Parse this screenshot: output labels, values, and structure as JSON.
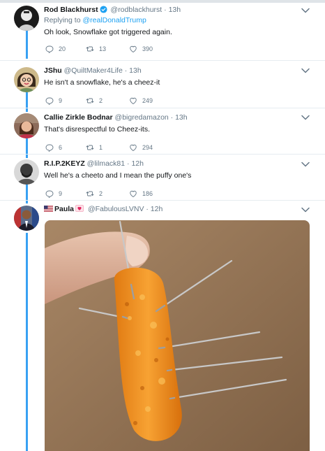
{
  "tweets": [
    {
      "name": "Rod Blackhurst",
      "handle": "@rodblackhurst",
      "time": "13h",
      "verified": true,
      "reply_prefix": "Replying to",
      "reply_to": "@realDonaldTrump",
      "text": "Oh look, Snowflake got triggered again.",
      "replies": "20",
      "retweets": "13",
      "likes": "390"
    },
    {
      "name": "JShu",
      "handle": "@QuiltMaker4Life",
      "time": "13h",
      "text": "He isn't a snowflake, he's a cheez-it",
      "replies": "9",
      "retweets": "2",
      "likes": "249"
    },
    {
      "name": "Callie Zirkle Bodnar",
      "handle": "@bigredamazon",
      "time": "13h",
      "text": "That's disrespectful to Cheez-its.",
      "replies": "6",
      "retweets": "1",
      "likes": "294"
    },
    {
      "name": "R.I.P.2KEYZ",
      "handle": "@lilmack81",
      "time": "12h",
      "text": "Well he's a cheeto and I mean the puffy one's",
      "replies": "9",
      "retweets": "2",
      "likes": "186"
    },
    {
      "name": "Paula",
      "handle": "@FabulousLVNV",
      "time": "12h"
    }
  ],
  "separator": "·",
  "colors": {
    "accent": "#1da1f2",
    "thread": "#38a1f3",
    "muted": "#657786",
    "divider": "#e6ecf0"
  },
  "icons": [
    "reply-icon",
    "retweet-icon",
    "like-icon",
    "caret-down-icon",
    "verified-badge-icon",
    "us-flag-icon",
    "heart-emoji-icon"
  ]
}
